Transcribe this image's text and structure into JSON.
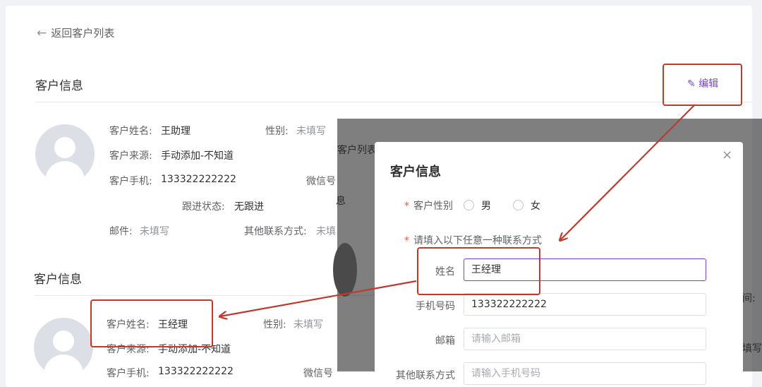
{
  "nav": {
    "back_label": "返回客户列表"
  },
  "section1": {
    "title": "客户信息",
    "edit_label": "编辑",
    "fields": {
      "name_label": "客户姓名:",
      "name_value": "王助理",
      "gender_label": "性别:",
      "gender_value": "未填写",
      "source_label": "客户来源:",
      "source_value": "手动添加-不知道",
      "phone_label": "客户手机:",
      "phone_value": "133322222222",
      "wechat_label": "微信号",
      "status_label": "跟进状态:",
      "status_value": "无跟进",
      "mail_label": "邮件:",
      "mail_value": "未填写",
      "other_label": "其他联系方式:",
      "other_value": "未填"
    }
  },
  "section2": {
    "title": "客户信息",
    "fields": {
      "name_label": "客户姓名:",
      "name_value": "王经理",
      "gender_label": "性别:",
      "gender_value": "未填写",
      "source_label": "客户来源:",
      "source_value": "手动添加-不知道",
      "phone_label": "客户手机:",
      "phone_value": "133322222222",
      "wechat_label": "微信号"
    }
  },
  "background_partial": {
    "list_fragment": "客户列表",
    "info_fragment": "息",
    "right_a": "间:",
    "right_b": "填写"
  },
  "modal": {
    "title": "客户信息",
    "close_glyph": "×",
    "gender_label": "客户性别",
    "gender_options": [
      "男",
      "女"
    ],
    "contact_hint": "请填入以下任意一种联系方式",
    "name_label": "姓名",
    "name_value": "王经理",
    "phone_label": "手机号码",
    "phone_value": "133322222222",
    "email_label": "邮箱",
    "email_placeholder": "请输入邮箱",
    "other_label": "其他联系方式",
    "other_placeholder": "请输入手机号码"
  },
  "colors": {
    "accent": "#7b3fd6",
    "annotation": "#c0392b",
    "required": "#e25c4a"
  }
}
